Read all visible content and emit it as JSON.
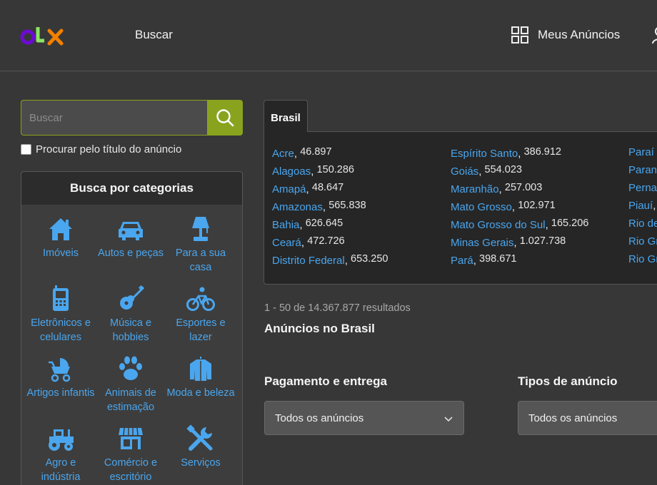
{
  "header": {
    "logo_text": "olx",
    "brand_colors": {
      "o": "#6e0ad6",
      "l": "#8ce563",
      "x": "#f28000"
    },
    "nav_search": "Buscar",
    "my_ads": "Meus Anúncios"
  },
  "search": {
    "placeholder": "Buscar",
    "title_only_label": "Procurar pelo título do anúncio",
    "button_color": "#8aa31f"
  },
  "categories": {
    "title": "Busca por categorias",
    "items": [
      {
        "label": "Imóveis",
        "icon": "house-icon"
      },
      {
        "label": "Autos e peças",
        "icon": "car-icon"
      },
      {
        "label": "Para a sua casa",
        "icon": "lamp-icon"
      },
      {
        "label": "Eletrônicos e celulares",
        "icon": "phone-icon"
      },
      {
        "label": "Música e hobbies",
        "icon": "guitar-icon"
      },
      {
        "label": "Esportes e lazer",
        "icon": "bicycle-icon"
      },
      {
        "label": "Artigos infantis",
        "icon": "stroller-icon"
      },
      {
        "label": "Animais de estimação",
        "icon": "paw-icon"
      },
      {
        "label": "Moda e beleza",
        "icon": "jacket-icon"
      },
      {
        "label": "Agro e indústria",
        "icon": "tractor-icon"
      },
      {
        "label": "Comércio e escritório",
        "icon": "store-icon"
      },
      {
        "label": "Serviços",
        "icon": "tools-icon"
      }
    ]
  },
  "regions": {
    "tab_label": "Brasil",
    "columns": [
      [
        {
          "name": "Acre",
          "count": "46.897"
        },
        {
          "name": "Alagoas",
          "count": "150.286"
        },
        {
          "name": "Amapá",
          "count": "48.647"
        },
        {
          "name": "Amazonas",
          "count": "565.838"
        },
        {
          "name": "Bahia",
          "count": "626.645"
        },
        {
          "name": "Ceará",
          "count": "472.726"
        },
        {
          "name": "Distrito Federal",
          "count": "653.250"
        }
      ],
      [
        {
          "name": "Espírito Santo",
          "count": "386.912"
        },
        {
          "name": "Goiás",
          "count": "554.023"
        },
        {
          "name": "Maranhão",
          "count": "257.003"
        },
        {
          "name": "Mato Grosso",
          "count": "102.971"
        },
        {
          "name": "Mato Grosso do Sul",
          "count": "165.206"
        },
        {
          "name": "Minas Gerais",
          "count": "1.027.738"
        },
        {
          "name": "Pará",
          "count": "398.671"
        }
      ],
      [
        {
          "name": "Paraí",
          "count": ""
        },
        {
          "name": "Paran",
          "count": ""
        },
        {
          "name": "Perna",
          "count": ""
        },
        {
          "name": "Piauí",
          "count": ""
        },
        {
          "name": "Rio de",
          "count": ""
        },
        {
          "name": "Rio Gr",
          "count": ""
        },
        {
          "name": "Rio Gr",
          "count": ""
        }
      ]
    ]
  },
  "results": {
    "summary": "1 - 50 de 14.367.877 resultados",
    "heading": "Anúncios no Brasil"
  },
  "filters": {
    "payment_label": "Pagamento e entrega",
    "payment_value": "Todos os anúncios",
    "type_label": "Tipos de anúncio",
    "type_value": "Todos os anúncios"
  },
  "colors": {
    "link": "#4aa6ee",
    "background": "#373737",
    "panel": "#262626"
  }
}
